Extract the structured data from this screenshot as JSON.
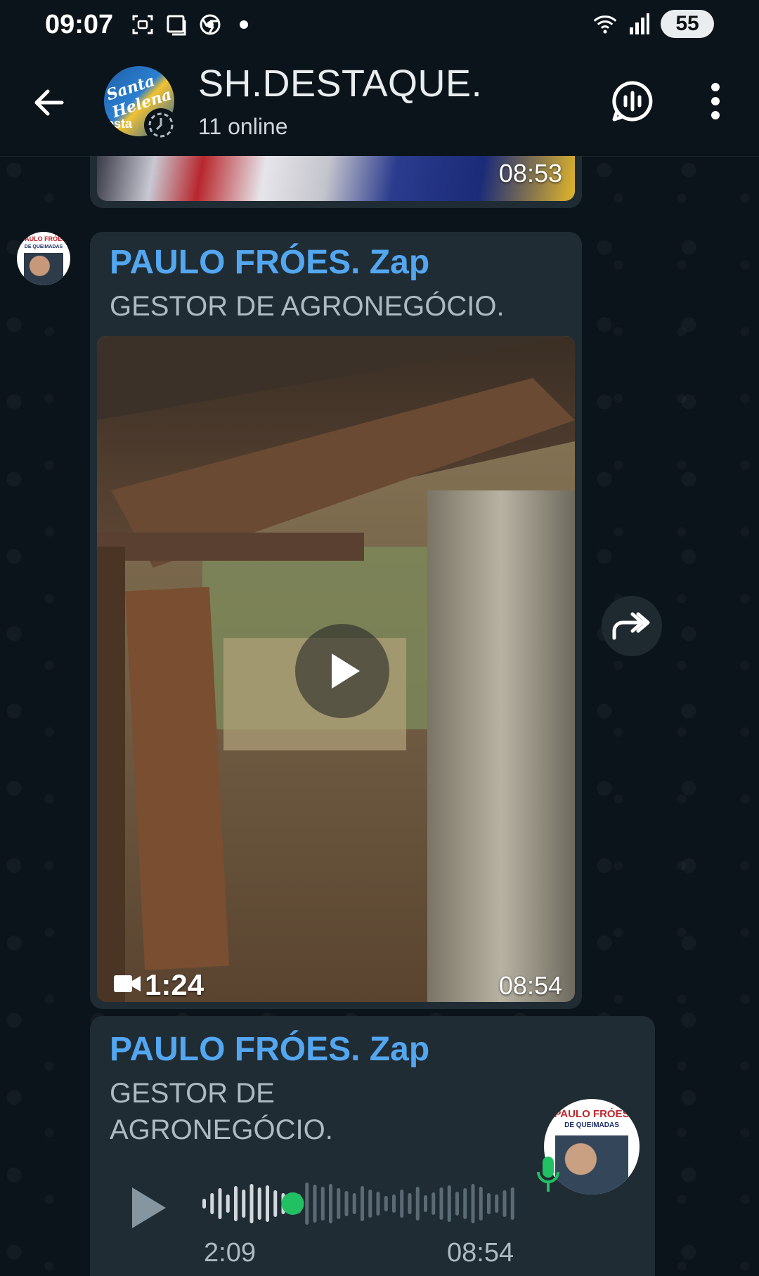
{
  "status_bar": {
    "time": "09:07",
    "battery": "55",
    "icons_left": [
      "screenshot-icon",
      "screen-cast-icon",
      "chrome-icon",
      "notification-dot-icon"
    ],
    "icons_right": [
      "wifi-icon",
      "signal-icon",
      "battery-icon"
    ]
  },
  "header": {
    "title": "SH.DESTAQUE.",
    "subtitle": "11 online",
    "avatar_text": "Santa Helena",
    "avatar_sub": "esta"
  },
  "messages": {
    "previous": {
      "time": "08:53"
    },
    "video": {
      "sender": "PAULO FRÓES. Zap",
      "role": "GESTOR DE AGRONEGÓCIO.",
      "duration": "1:24",
      "time": "08:54",
      "avatar_banner": "PAULO FRÓES",
      "avatar_banner2": "DE QUEIMADAS"
    },
    "audio": {
      "sender": "PAULO FRÓES. Zap",
      "role_line1": "GESTOR DE",
      "role_line2": "AGRONEGÓCIO.",
      "duration": "2:09",
      "time": "08:54",
      "progress": 0.29,
      "avatar_banner": "PAULO FRÓES",
      "avatar_banner2": "DE QUEIMADAS"
    }
  },
  "colors": {
    "background": "#0b141a",
    "bubble": "#202c33",
    "sender_name": "#53a6f0",
    "accent_green": "#21c063"
  }
}
